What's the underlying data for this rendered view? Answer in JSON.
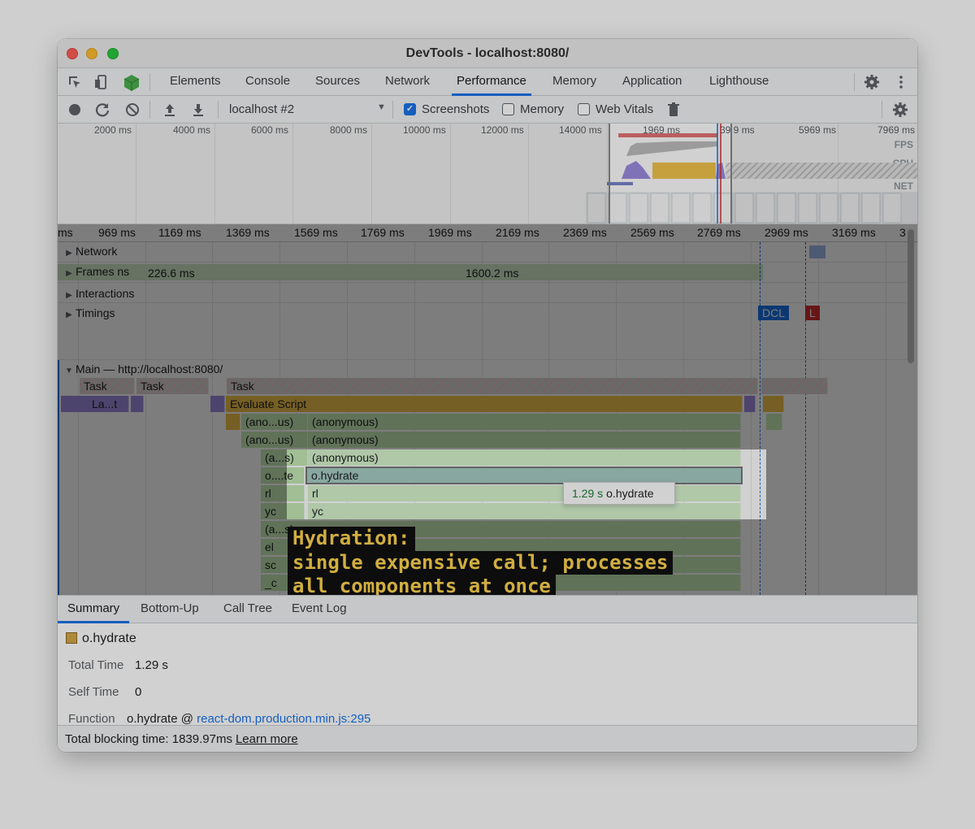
{
  "window": {
    "title": "DevTools - localhost:8080/"
  },
  "tabs": [
    {
      "label": "Elements"
    },
    {
      "label": "Console"
    },
    {
      "label": "Sources"
    },
    {
      "label": "Network"
    },
    {
      "label": "Performance"
    },
    {
      "label": "Memory"
    },
    {
      "label": "Application"
    },
    {
      "label": "Lighthouse"
    }
  ],
  "toolbar": {
    "profile_select": "localhost #2",
    "screenshots_label": "Screenshots",
    "memory_label": "Memory",
    "webvitals_label": "Web Vitals"
  },
  "overview": {
    "ticks": [
      "2000 ms",
      "4000 ms",
      "6000 ms",
      "8000 ms",
      "10000 ms",
      "12000 ms",
      "14000 ms",
      "1969 ms",
      "39 9 ms",
      "5969 ms",
      "7969 ms"
    ],
    "labels": {
      "fps": "FPS",
      "cpu": "CPU",
      "net": "NET"
    }
  },
  "ruler": {
    "ticks": [
      "ms",
      "969 ms",
      "1169 ms",
      "1369 ms",
      "1569 ms",
      "1769 ms",
      "1969 ms",
      "2169 ms",
      "2369 ms",
      "2569 ms",
      "2769 ms",
      "2969 ms",
      "3169 ms",
      "3"
    ]
  },
  "tracks": {
    "network": "Network",
    "frames": "Frames",
    "frames_ns": "ns",
    "frame1": "226.6 ms",
    "frame2": "1600.2 ms",
    "interactions": "Interactions",
    "timings": "Timings",
    "dcl": "DCL",
    "l": "L",
    "main": "Main — http://localhost:8080/"
  },
  "flame": {
    "task1": "Task",
    "task2": "Task",
    "task3": "Task",
    "lat": "La...t",
    "eval": "Evaluate Script",
    "r1a": "(ano...us)",
    "r1b": "(anonymous)",
    "r2a": "(ano...us)",
    "r2b": "(anonymous)",
    "r3a": "(a...s)",
    "r3b": "(anonymous)",
    "r4a": "o....te",
    "r4b": "o.hydrate",
    "r5a": "rl",
    "r5b": "rl",
    "r6a": "yc",
    "r6b": "yc",
    "r7a": "(a...s)",
    "r8a": "el",
    "r9a": "sc",
    "r10a": "_c"
  },
  "tooltip": {
    "time": "1.29 s",
    "name": "o.hydrate"
  },
  "caption": {
    "line1": "Hydration:",
    "line2": "single expensive call; processes",
    "line3": "all components at once"
  },
  "bottom_tabs": [
    {
      "label": "Summary"
    },
    {
      "label": "Bottom-Up"
    },
    {
      "label": "Call Tree"
    },
    {
      "label": "Event Log"
    }
  ],
  "summary": {
    "name": "o.hydrate",
    "total_time_label": "Total Time",
    "total_time": "1.29 s",
    "self_time_label": "Self Time",
    "self_time": "0",
    "function_label": "Function",
    "function_name": "o.hydrate @ ",
    "function_link": "react-dom.production.min.js:295"
  },
  "footer": {
    "blocking": "Total blocking time: 1839.97ms",
    "learn_more": "Learn more"
  },
  "colors": {
    "accent": "#1a73e8",
    "eval_script": "#f2c44b",
    "caption_text": "#ffd54f"
  }
}
